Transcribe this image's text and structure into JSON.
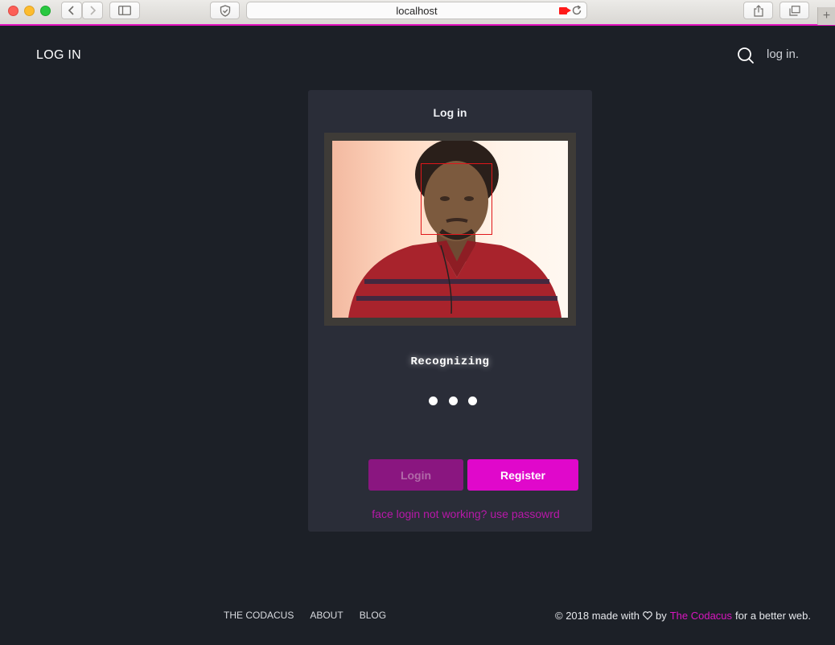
{
  "browser": {
    "url": "localhost",
    "new_tab_label": "+"
  },
  "header": {
    "logo": "LOG IN",
    "login_link": "log in.",
    "search_icon": "search-icon"
  },
  "card": {
    "title": "Log in",
    "status": "Recognizing",
    "buttons": {
      "login": "Login",
      "register": "Register"
    },
    "fallback_link": "face login not working? use passowrd"
  },
  "footer": {
    "nav": [
      "THE CODACUS",
      "ABOUT",
      "BLOG"
    ],
    "copyright_prefix": "© 2018 made with",
    "by": "by",
    "brand": "The Codacus",
    "suffix": "for a better web."
  },
  "colors": {
    "accent": "#e008cb",
    "accent_dark": "#8a1680",
    "page_bg": "#1c2027",
    "card_bg": "#2a2d38"
  }
}
